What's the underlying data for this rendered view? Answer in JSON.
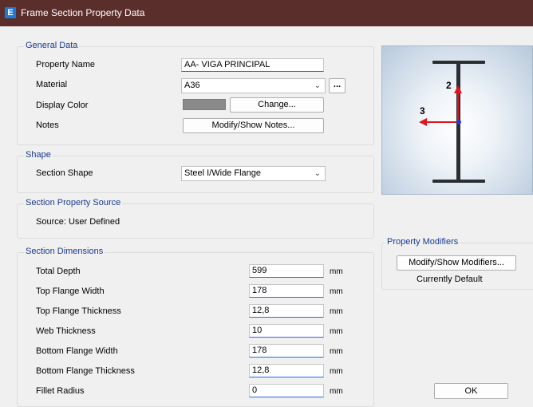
{
  "window": {
    "app_icon_letter": "E",
    "title": "Frame Section Property Data"
  },
  "general_data": {
    "legend": "General Data",
    "property_name_label": "Property Name",
    "property_name_value": "AA- VIGA PRINCIPAL",
    "material_label": "Material",
    "material_value": "A36",
    "material_browse_label": "...",
    "display_color_label": "Display Color",
    "display_color_value": "#8a8a8a",
    "change_button_label": "Change...",
    "notes_label": "Notes",
    "notes_button_label": "Modify/Show Notes..."
  },
  "shape": {
    "legend": "Shape",
    "section_shape_label": "Section Shape",
    "section_shape_value": "Steel I/Wide Flange"
  },
  "source": {
    "legend": "Section Property Source",
    "text": "Source:  User Defined"
  },
  "dimensions": {
    "legend": "Section Dimensions",
    "rows": [
      {
        "label": "Total Depth",
        "value": "599",
        "unit": "mm"
      },
      {
        "label": "Top Flange Width",
        "value": "178",
        "unit": "mm"
      },
      {
        "label": "Top Flange Thickness",
        "value": "12,8",
        "unit": "mm"
      },
      {
        "label": "Web Thickness",
        "value": "10",
        "unit": "mm"
      },
      {
        "label": "Bottom Flange Width",
        "value": "178",
        "unit": "mm"
      },
      {
        "label": "Bottom Flange Thickness",
        "value": "12,8",
        "unit": "mm"
      },
      {
        "label": "Fillet Radius",
        "value": "0",
        "unit": "mm"
      }
    ]
  },
  "preview": {
    "axis_2_label": "2",
    "axis_3_label": "3",
    "axis_color": "#e0141c",
    "section_color": "#2a2e33"
  },
  "modifiers": {
    "legend": "Property Modifiers",
    "button_label": "Modify/Show Modifiers...",
    "status": "Currently Default"
  },
  "ok_button_label": "OK"
}
